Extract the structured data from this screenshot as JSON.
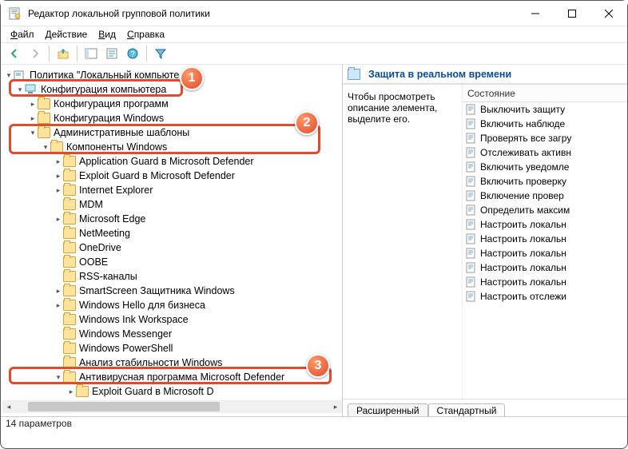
{
  "window": {
    "title": "Редактор локальной групповой политики"
  },
  "menu": {
    "file": "Файл",
    "action": "Действие",
    "view": "Вид",
    "help": "Справка"
  },
  "tree": {
    "root": "Политика \"Локальный компьюте",
    "comp_config": "Конфигурация компьютера",
    "prog_config": "Конфигурация программ",
    "win_config": "Конфигурация Windows",
    "admin_templates": "Административные шаблоны",
    "win_components": "Компоненты Windows",
    "items": [
      "Application Guard в Microsoft Defender",
      "Exploit Guard в Microsoft Defender",
      "Internet Explorer",
      "MDM",
      "Microsoft Edge",
      "NetMeeting",
      "OneDrive",
      "OOBE",
      "RSS-каналы",
      "SmartScreen Защитника Windows",
      "Windows Hello для бизнеса",
      "Windows Ink Workspace",
      "Windows Messenger",
      "Windows PowerShell",
      "Анализ стабильности Windows"
    ],
    "defender": "Антивирусная программа Microsoft Defender",
    "defender_sub": "Exploit Guard в Microsoft D"
  },
  "right": {
    "title": "Защита в реальном времени",
    "desc": "Чтобы просмотреть описание элемента, выделите его.",
    "col_state": "Состояние",
    "items": [
      "Выключить защиту",
      "Включить наблюде",
      "Проверять все загру",
      "Отслеживать активн",
      "Включить уведомле",
      "Включить проверку",
      "Включение провер",
      "Определить максим",
      "Настроить локальн",
      "Настроить локальн",
      "Настроить локальн",
      "Настроить локальн",
      "Настроить локальн",
      "Настроить отслежи"
    ],
    "tab_ext": "Расширенный",
    "tab_std": "Стандартный"
  },
  "status": "14 параметров",
  "badges": {
    "b1": "1",
    "b2": "2",
    "b3": "3"
  }
}
